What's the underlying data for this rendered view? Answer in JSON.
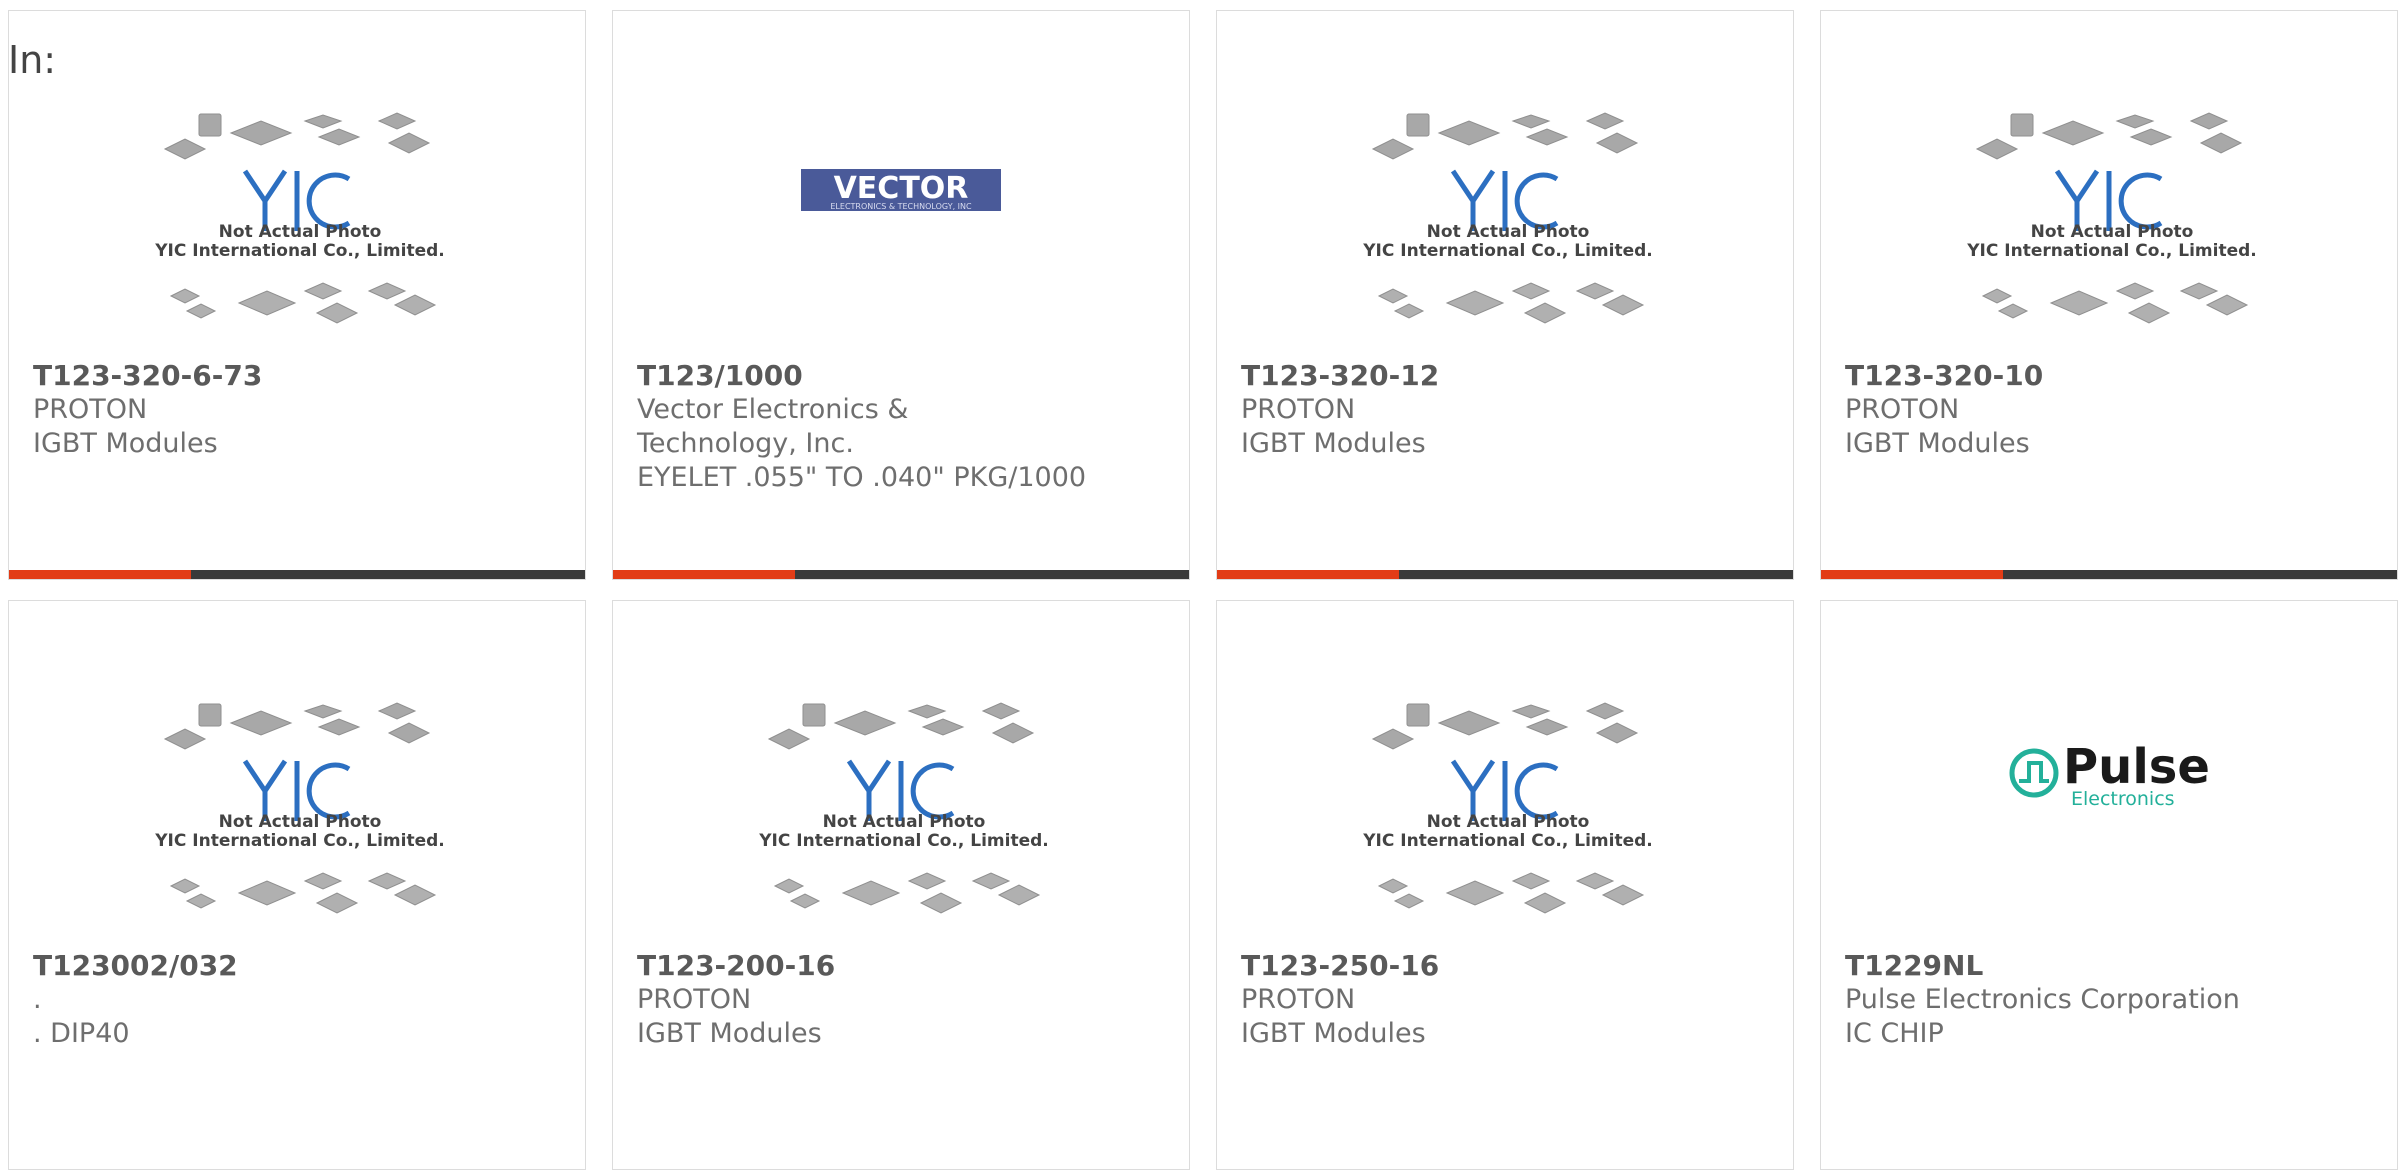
{
  "page": {
    "filter_label": "In:"
  },
  "colors": {
    "accent_bar": "#e23c16",
    "bar_dark": "#3a3a3a",
    "yic_blue": "#2c6fc1",
    "vector_navy": "#4a5a99",
    "pulse_teal": "#23b09a"
  },
  "products": [
    {
      "image": "yic-placeholder-photo",
      "part_number": "T123-320-6-73",
      "manufacturer": "PROTON",
      "description": "IGBT Modules"
    },
    {
      "image": "vector-logo",
      "part_number": "T123/1000",
      "manufacturer": "Vector Electronics & Technology, Inc.",
      "description": "EYELET .055\" TO .040\" PKG/1000"
    },
    {
      "image": "yic-placeholder-photo",
      "part_number": "T123-320-12",
      "manufacturer": "PROTON",
      "description": "IGBT Modules"
    },
    {
      "image": "yic-placeholder-photo",
      "part_number": "T123-320-10",
      "manufacturer": "PROTON",
      "description": "IGBT Modules"
    },
    {
      "image": "yic-placeholder-photo",
      "part_number": "T123002/032",
      "manufacturer": ".",
      "description": ". DIP40"
    },
    {
      "image": "yic-placeholder-photo",
      "part_number": "T123-200-16",
      "manufacturer": "PROTON",
      "description": "IGBT Modules"
    },
    {
      "image": "yic-placeholder-photo",
      "part_number": "T123-250-16",
      "manufacturer": "PROTON",
      "description": "IGBT Modules"
    },
    {
      "image": "pulse-logo",
      "part_number": "T1229NL",
      "manufacturer": "Pulse Electronics Corporation",
      "description": "IC CHIP"
    }
  ],
  "image_text": {
    "yic_logo": "YIC",
    "placeholder_line1": "Not Actual Photo",
    "placeholder_line2": "YIC International Co., Limited.",
    "vector_name": "VECTOR",
    "vector_sub": "ELECTRONICS & TECHNOLOGY, INC",
    "pulse_name": "Pulse",
    "pulse_sub": "Electronics"
  }
}
